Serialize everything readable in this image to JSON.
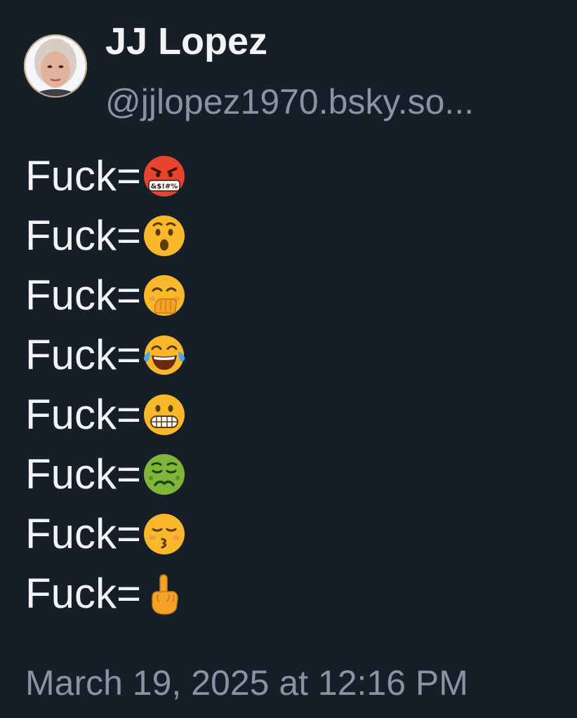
{
  "post": {
    "author": {
      "display_name": "JJ Lopez",
      "handle": "@jjlopez1970.bsky.so..."
    },
    "lines": [
      {
        "text": "Fuck=",
        "emoji": "enraged-face-with-symbols",
        "symbols": "&$!#%"
      },
      {
        "text": "Fuck=",
        "emoji": "hushed-surprised-face"
      },
      {
        "text": "Fuck=",
        "emoji": "face-with-hand-over-mouth"
      },
      {
        "text": "Fuck=",
        "emoji": "face-with-tears-of-joy"
      },
      {
        "text": "Fuck=",
        "emoji": "grimacing-face"
      },
      {
        "text": "Fuck=",
        "emoji": "nauseated-face"
      },
      {
        "text": "Fuck=",
        "emoji": "kissing-face-closed-eyes"
      },
      {
        "text": "Fuck=",
        "emoji": "middle-finger"
      }
    ],
    "timestamp": "March 19, 2025 at 12:16 PM"
  },
  "colors": {
    "background": "#161e27",
    "text": "#f1f3f5",
    "muted": "#8794a6"
  }
}
